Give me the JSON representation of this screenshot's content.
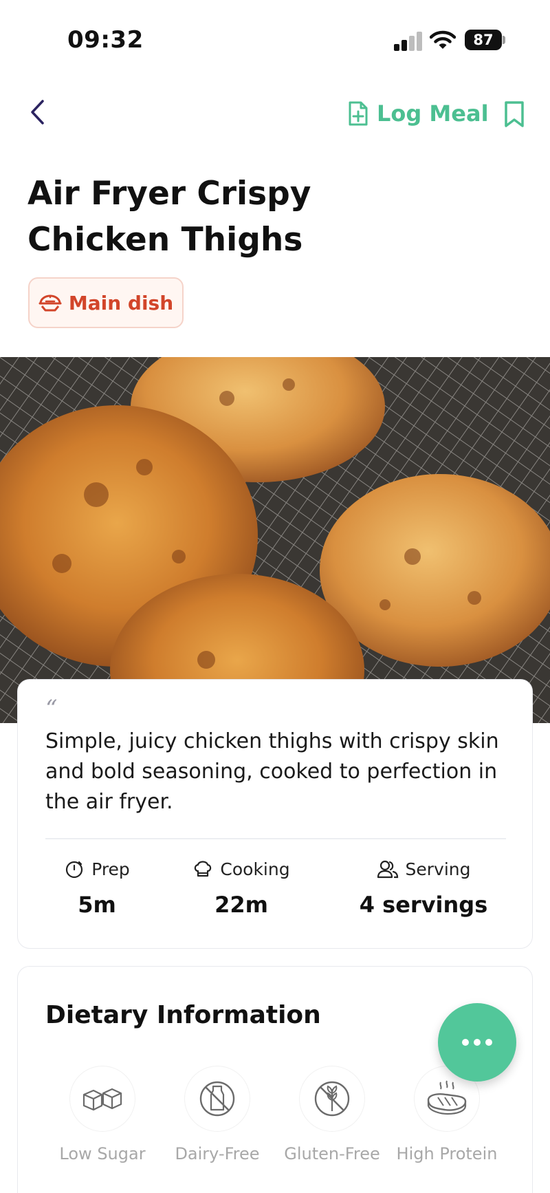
{
  "status_bar": {
    "time": "09:32",
    "battery": "87",
    "icons": [
      "cellular-signal-icon",
      "wifi-icon",
      "battery-icon"
    ]
  },
  "nav": {
    "back_icon": "chevron-left-icon",
    "log_meal_label": "Log Meal",
    "log_meal_icon": "document-plus-icon",
    "bookmark_icon": "bookmark-icon"
  },
  "recipe": {
    "title_line1": "Air Fryer Crispy",
    "title_line2": "Chicken Thighs",
    "category": "Main dish",
    "category_icon": "dish-icon",
    "description": "Simple, juicy chicken thighs with crispy skin and bold seasoning, cooked to perfection in the air fryer.",
    "quote_mark": "“"
  },
  "stats": [
    {
      "label": "Prep",
      "value": "5m",
      "icon": "timer-icon"
    },
    {
      "label": "Cooking",
      "value": "22m",
      "icon": "chef-hat-icon"
    },
    {
      "label": "Serving",
      "value": "4 servings",
      "icon": "users-icon"
    }
  ],
  "dietary": {
    "title": "Dietary Information",
    "items": [
      {
        "label": "Low Sugar",
        "icon": "sugar-cubes-icon"
      },
      {
        "label": "Dairy-Free",
        "icon": "no-milk-icon"
      },
      {
        "label": "Gluten-Free",
        "icon": "no-wheat-icon"
      },
      {
        "label": "High Protein",
        "icon": "steak-icon"
      }
    ]
  },
  "fab": {
    "icon": "more-dots-icon"
  },
  "colors": {
    "accent_green": "#4cbf91",
    "fab_green": "#52c79a",
    "tag_red": "#d2452a",
    "tag_bg": "#fff6f2",
    "nav_back": "#2b2360"
  }
}
